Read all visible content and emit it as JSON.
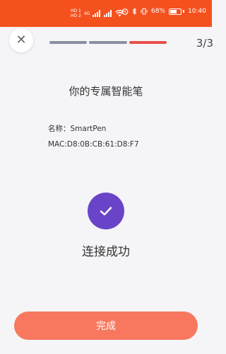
{
  "status_bar": {
    "hd1": "HD 1",
    "hd2": "HD 2",
    "network": "4G",
    "battery": "68%",
    "time": "10:40",
    "battery_level": 0.68
  },
  "header": {
    "close_label": "✕",
    "step_counter": "3/3",
    "progress_colors": [
      "#8a8fa0",
      "#8a8fa0",
      "#e8504a"
    ]
  },
  "main": {
    "title": "你的专属智能笔",
    "device_name": "名称：SmartPen",
    "device_mac": "MAC:D8:0B:CB:61:D8:F7",
    "success_text": "连接成功"
  },
  "footer": {
    "done_label": "完成"
  },
  "colors": {
    "status_bar": "#f4511e",
    "accent_purple": "#6a44c8",
    "button": "#f7785e"
  }
}
